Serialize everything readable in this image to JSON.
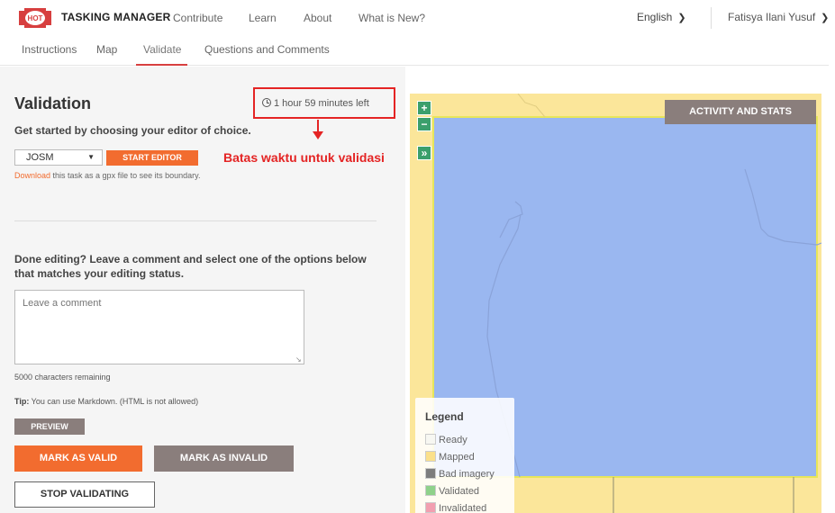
{
  "header": {
    "logo_label": "HOT",
    "app_name": "TASKING MANAGER",
    "nav": [
      "Contribute",
      "Learn",
      "About",
      "What is New?"
    ],
    "language": "English",
    "user": "Fatisya Ilani Yusuf"
  },
  "tabs": [
    "Instructions",
    "Map",
    "Validate",
    "Questions and Comments"
  ],
  "validation": {
    "title": "Validation",
    "timer": "1 hour 59 minutes left",
    "annotation": "Batas waktu untuk validasi",
    "subtitle": "Get started by choosing your editor of choice.",
    "editor_selected": "JOSM",
    "start_editor": "START EDITOR",
    "download_link": "Download",
    "download_rest": " this task as a gpx file to see its boundary.",
    "done_text": "Done editing? Leave a comment and select one of the options below that matches your editing status.",
    "comment_placeholder": "Leave a comment",
    "chars_remaining": "5000 characters remaining",
    "tip_label": "Tip:",
    "tip_text": " You can use Markdown. (HTML is not allowed)",
    "preview": "PREVIEW",
    "mark_valid": "MARK AS VALID",
    "mark_invalid": "MARK AS INVALID",
    "stop_validating": "STOP VALIDATING"
  },
  "map": {
    "zoom_in": "+",
    "zoom_out": "−",
    "expand": "»",
    "activity_button": "ACTIVITY AND STATS",
    "legend": {
      "title": "Legend",
      "items": [
        {
          "label": "Ready",
          "color": "#f7f7f2"
        },
        {
          "label": "Mapped",
          "color": "#fbe08a"
        },
        {
          "label": "Bad imagery",
          "color": "#7d7d7d"
        },
        {
          "label": "Validated",
          "color": "#8fd18b"
        },
        {
          "label": "Invalidated",
          "color": "#f29fb0"
        }
      ]
    }
  },
  "colors": {
    "accent": "#f26c2f",
    "secondary": "#8a7e7c",
    "highlight": "#e42424",
    "selected_task": "#9ab7f0",
    "mapped": "#fbe69a"
  }
}
